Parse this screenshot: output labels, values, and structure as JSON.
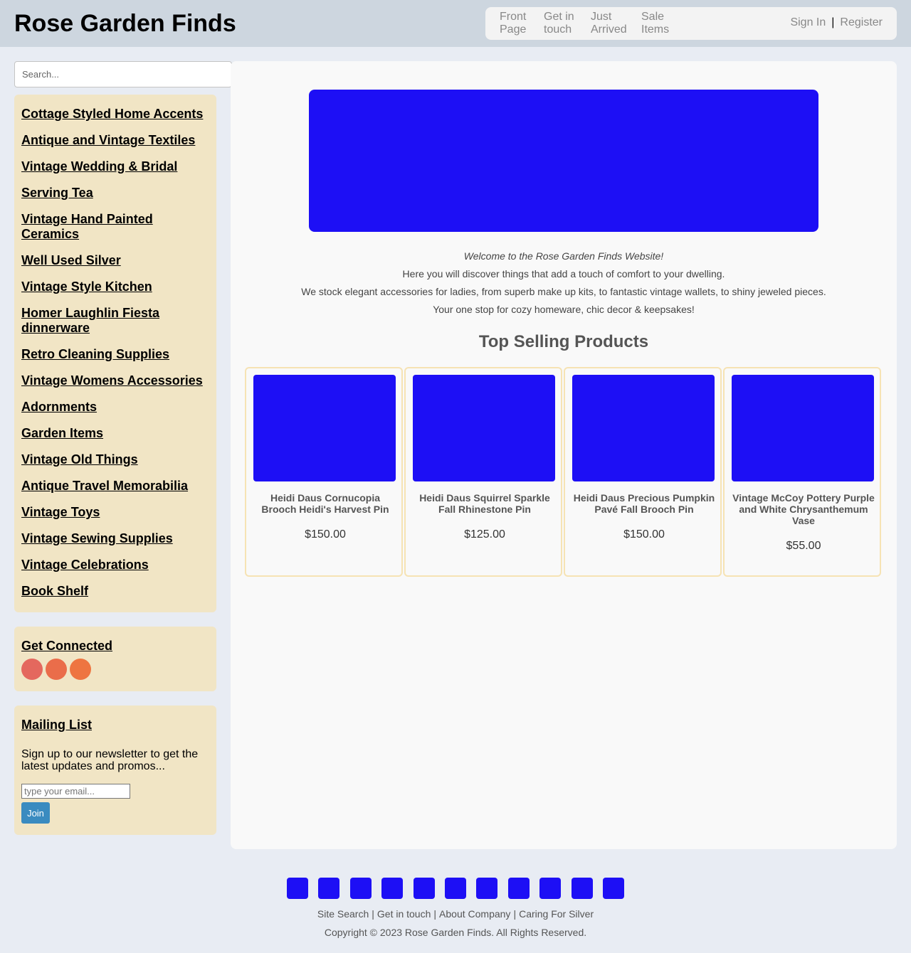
{
  "header": {
    "title": "Rose Garden Finds",
    "nav": [
      "Front Page",
      "Get in touch",
      "Just Arrived",
      "Sale Items"
    ],
    "sign_in": "Sign In",
    "separator": "|",
    "register": "Register"
  },
  "search": {
    "placeholder": "Search..."
  },
  "sidebar": {
    "categories": [
      "Cottage Styled Home Accents",
      "Antique and Vintage Textiles",
      "Vintage Wedding & Bridal",
      "Serving Tea",
      "Vintage Hand Painted Ceramics",
      "Well Used Silver",
      "Vintage Style Kitchen",
      "Homer Laughlin Fiesta dinnerware",
      "Retro Cleaning Supplies",
      "Vintage Womens Accessories",
      "Adornments",
      "Garden Items",
      "Vintage Old Things",
      "Antique Travel Memorabilia",
      "Vintage Toys",
      "Vintage Sewing Supplies",
      "Vintage Celebrations",
      "Book Shelf"
    ],
    "connected": {
      "title": "Get Connected",
      "social_colors": [
        "#e4685e",
        "#ea6d4a",
        "#ee7541"
      ]
    },
    "mailing": {
      "title": "Mailing List",
      "text": "Sign up to our newsletter to get the latest updates and promos...",
      "email_placeholder": "type your email...",
      "join_label": "Join"
    }
  },
  "main": {
    "welcome": "Welcome to the Rose Garden Finds Website!",
    "intro_lines": [
      "Here you will discover things that add a touch of comfort to your dwelling.",
      "We stock elegant accessories for ladies, from superb make up kits, to fantastic vintage wallets, to shiny jeweled pieces.",
      "Your one stop for cozy homeware, chic decor & keepsakes!"
    ],
    "section_title": "Top Selling Products",
    "products": [
      {
        "name": "Heidi Daus Cornucopia Brooch Heidi's Harvest Pin",
        "price": "$150.00"
      },
      {
        "name": "Heidi Daus Squirrel Sparkle Fall Rhinestone Pin",
        "price": "$125.00"
      },
      {
        "name": "Heidi Daus Precious Pumpkin Pavé Fall Brooch Pin",
        "price": "$150.00"
      },
      {
        "name": "Vintage McCoy Pottery Purple and White Chrysanthemum Vase",
        "price": "$55.00"
      }
    ]
  },
  "footer": {
    "links": [
      "Site Search",
      "Get in touch",
      "About Company",
      "Caring For Silver"
    ],
    "link_separator": "|",
    "copyright": "Copyright © 2023 Rose Garden Finds. All Rights Reserved."
  },
  "colors": {
    "image_placeholder": "#1d0ff5",
    "sidebar_bg": "#f1e5c5",
    "join_button": "#3a8bc0"
  }
}
